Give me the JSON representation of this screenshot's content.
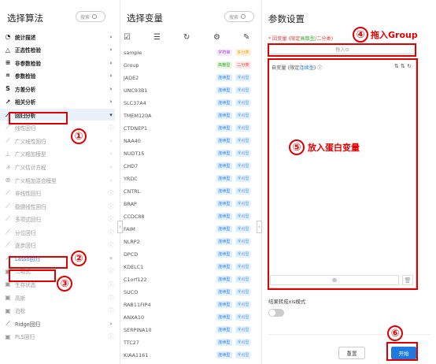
{
  "algorithms": {
    "title": "选择算法",
    "search_label": "搜索",
    "items": [
      {
        "icon": "◔",
        "icon_name": "pie-chart-icon",
        "label": "统计描述",
        "arrow": "›",
        "style": "dark"
      },
      {
        "icon": "△",
        "icon_name": "triangle-icon",
        "label": "正态性检验",
        "arrow": "›",
        "style": "dark"
      },
      {
        "icon": "≡",
        "icon_name": "lines-icon",
        "label": "非参数检验",
        "arrow": "›",
        "style": "dark"
      },
      {
        "icon": "⌗",
        "icon_name": "grid-icon",
        "label": "参数检验",
        "arrow": "›",
        "style": "dark"
      },
      {
        "icon": "S",
        "icon_name": "variance-icon",
        "label": "方差分析",
        "arrow": "›",
        "style": "dark"
      },
      {
        "icon": "↗",
        "icon_name": "correlation-icon",
        "label": "相关分析",
        "arrow": "›",
        "style": "dark"
      },
      {
        "icon": "⟋",
        "icon_name": "regression-icon",
        "label": "回归分析",
        "arrow": "▾",
        "style": "selected"
      },
      {
        "icon": "⟋",
        "icon_name": "linear-regression-icon",
        "label": "线性回归",
        "arrow": "ⓘ",
        "style": "sub"
      },
      {
        "icon": "⟋",
        "icon_name": "glm-icon",
        "label": "广义线性回归",
        "arrow": "›",
        "style": "sub"
      },
      {
        "icon": "⊥",
        "icon_name": "gam-icon",
        "label": "广义相加模型",
        "arrow": "›",
        "style": "sub"
      },
      {
        "icon": "⩘",
        "icon_name": "gee-icon",
        "label": "广义估计方程",
        "arrow": "›",
        "style": "sub"
      },
      {
        "icon": "⊚",
        "icon_name": "gamm-icon",
        "label": "广义相加混合模型",
        "arrow": "›",
        "style": "sub"
      },
      {
        "icon": "⟋",
        "icon_name": "nonlinear-icon",
        "label": "非线性回归",
        "arrow": "ⓘ",
        "style": "sub"
      },
      {
        "icon": "⟋",
        "icon_name": "robust-icon",
        "label": "稳健线性回归",
        "arrow": "ⓘ",
        "style": "sub"
      },
      {
        "icon": "⟋",
        "icon_name": "polynomial-icon",
        "label": "多项式回归",
        "arrow": "ⓘ",
        "style": "sub"
      },
      {
        "icon": "⟋",
        "icon_name": "quantile-icon",
        "label": "分位回归",
        "arrow": "ⓘ",
        "style": "sub"
      },
      {
        "icon": "⟋",
        "icon_name": "stepwise-icon",
        "label": "逐步回归",
        "arrow": "ⓘ",
        "style": "sub"
      },
      {
        "icon": "⟋",
        "icon_name": "lasso-icon",
        "label": "Lasso回归",
        "arrow": "▾",
        "style": "lasso"
      },
      {
        "icon": "▣",
        "icon_name": "binary-icon",
        "label": "二项式",
        "arrow": "ⓘ",
        "style": "sub"
      },
      {
        "icon": "▣",
        "icon_name": "survival-icon",
        "label": "生存状态",
        "arrow": "ⓘ",
        "style": "sub"
      },
      {
        "icon": "▣",
        "icon_name": "gaussian-icon",
        "label": "高斯",
        "arrow": "ⓘ",
        "style": "sub"
      },
      {
        "icon": "▣",
        "icon_name": "poisson-icon",
        "label": "泊松",
        "arrow": "ⓘ",
        "style": "sub"
      },
      {
        "icon": "⟋",
        "icon_name": "ridge-icon",
        "label": "Ridge回归",
        "arrow": "›",
        "style": "mid"
      },
      {
        "icon": "▣",
        "icon_name": "pls-icon",
        "label": "PLS回归",
        "arrow": "ⓘ",
        "style": "sub"
      }
    ]
  },
  "variables": {
    "title": "选择变量",
    "search_label": "搜索",
    "collapse_glyph": "‹",
    "toolbar": [
      {
        "glyph": "☑",
        "name": "select-all-icon"
      },
      {
        "glyph": "☰",
        "name": "filter-icon"
      },
      {
        "glyph": "↻",
        "name": "refresh-icon"
      },
      {
        "glyph": "⚙",
        "name": "settings-icon"
      },
      {
        "glyph": "✎",
        "name": "edit-icon"
      }
    ],
    "rows": [
      {
        "name": "sample",
        "b1": "字符串",
        "b1t": "char",
        "b2": "多分类",
        "b2t": "multi"
      },
      {
        "name": "Group",
        "b1": "高散型",
        "b1t": "high",
        "b2": "二分类",
        "b2t": "bin"
      },
      {
        "name": "JADE2",
        "b1": "连续型",
        "b1t": "cont",
        "b2": "浮点型",
        "b2t": "float"
      },
      {
        "name": "UNC93B1",
        "b1": "连续型",
        "b1t": "cont",
        "b2": "浮点型",
        "b2t": "float"
      },
      {
        "name": "SLC37A4",
        "b1": "连续型",
        "b1t": "cont",
        "b2": "浮点型",
        "b2t": "float"
      },
      {
        "name": "TMEM120A",
        "b1": "连续型",
        "b1t": "cont",
        "b2": "浮点型",
        "b2t": "float"
      },
      {
        "name": "CTDNEP1",
        "b1": "连续型",
        "b1t": "cont",
        "b2": "浮点型",
        "b2t": "float"
      },
      {
        "name": "NAA40",
        "b1": "连续型",
        "b1t": "cont",
        "b2": "浮点型",
        "b2t": "float"
      },
      {
        "name": "NUDT15",
        "b1": "连续型",
        "b1t": "cont",
        "b2": "浮点型",
        "b2t": "float"
      },
      {
        "name": "CHD7",
        "b1": "连续型",
        "b1t": "cont",
        "b2": "浮点型",
        "b2t": "float"
      },
      {
        "name": "YRDC",
        "b1": "连续型",
        "b1t": "cont",
        "b2": "浮点型",
        "b2t": "float"
      },
      {
        "name": "CNTRL",
        "b1": "连续型",
        "b1t": "cont",
        "b2": "浮点型",
        "b2t": "float"
      },
      {
        "name": "BRAP",
        "b1": "连续型",
        "b1t": "cont",
        "b2": "浮点型",
        "b2t": "float"
      },
      {
        "name": "CCDC88",
        "b1": "连续型",
        "b1t": "cont",
        "b2": "浮点型",
        "b2t": "float"
      },
      {
        "name": "FAIM",
        "b1": "连续型",
        "b1t": "cont",
        "b2": "浮点型",
        "b2t": "float"
      },
      {
        "name": "NLRP2",
        "b1": "连续型",
        "b1t": "cont",
        "b2": "浮点型",
        "b2t": "float"
      },
      {
        "name": "DPCD",
        "b1": "连续型",
        "b1t": "cont",
        "b2": "浮点型",
        "b2t": "float"
      },
      {
        "name": "KDELC1",
        "b1": "连续型",
        "b1t": "cont",
        "b2": "浮点型",
        "b2t": "float"
      },
      {
        "name": "C1orf122",
        "b1": "连续型",
        "b1t": "cont",
        "b2": "浮点型",
        "b2t": "float"
      },
      {
        "name": "SUCO",
        "b1": "连续型",
        "b1t": "cont",
        "b2": "浮点型",
        "b2t": "float"
      },
      {
        "name": "RAB11FIP4",
        "b1": "连续型",
        "b1t": "cont",
        "b2": "浮点型",
        "b2t": "float"
      },
      {
        "name": "ANXA10",
        "b1": "连续型",
        "b1t": "cont",
        "b2": "浮点型",
        "b2t": "float"
      },
      {
        "name": "SERPINA10",
        "b1": "连续型",
        "b1t": "cont",
        "b2": "浮点型",
        "b2t": "float"
      },
      {
        "name": "TTC27",
        "b1": "连续型",
        "b1t": "cont",
        "b2": "浮点型",
        "b2t": "float"
      },
      {
        "name": "KIAA1161",
        "b1": "连续型",
        "b1t": "cont",
        "b2": "浮点型",
        "b2t": "float"
      }
    ]
  },
  "params": {
    "title": "参数设置",
    "dep_prefix": "* 因变量 (限定",
    "dep_type1": "高散型",
    "dep_sep": "/",
    "dep_type2": "二分类",
    "dep_suffix": ")",
    "drop_hint": "拖入⊙",
    "indep_prefix": "自变量 (限定",
    "indep_type": "连续型",
    "indep_suffix": ") ⓘ",
    "list_tools": "⇅ ⇅ ↻",
    "add_glyph": "⊕",
    "delete_glyph": "🗑",
    "excel_label": "结果转成xls模式",
    "reset_label": "重置",
    "start_label": "开始"
  },
  "annotations": {
    "a1": "①",
    "a2": "②",
    "a3": "③",
    "a4": "④",
    "a5": "⑤",
    "a6": "⑥",
    "a4_text": "拖入Group",
    "a5_text": "放入蛋白变量"
  },
  "colors": {
    "accent": "#1f7ae0",
    "annotation": "#e00000"
  }
}
